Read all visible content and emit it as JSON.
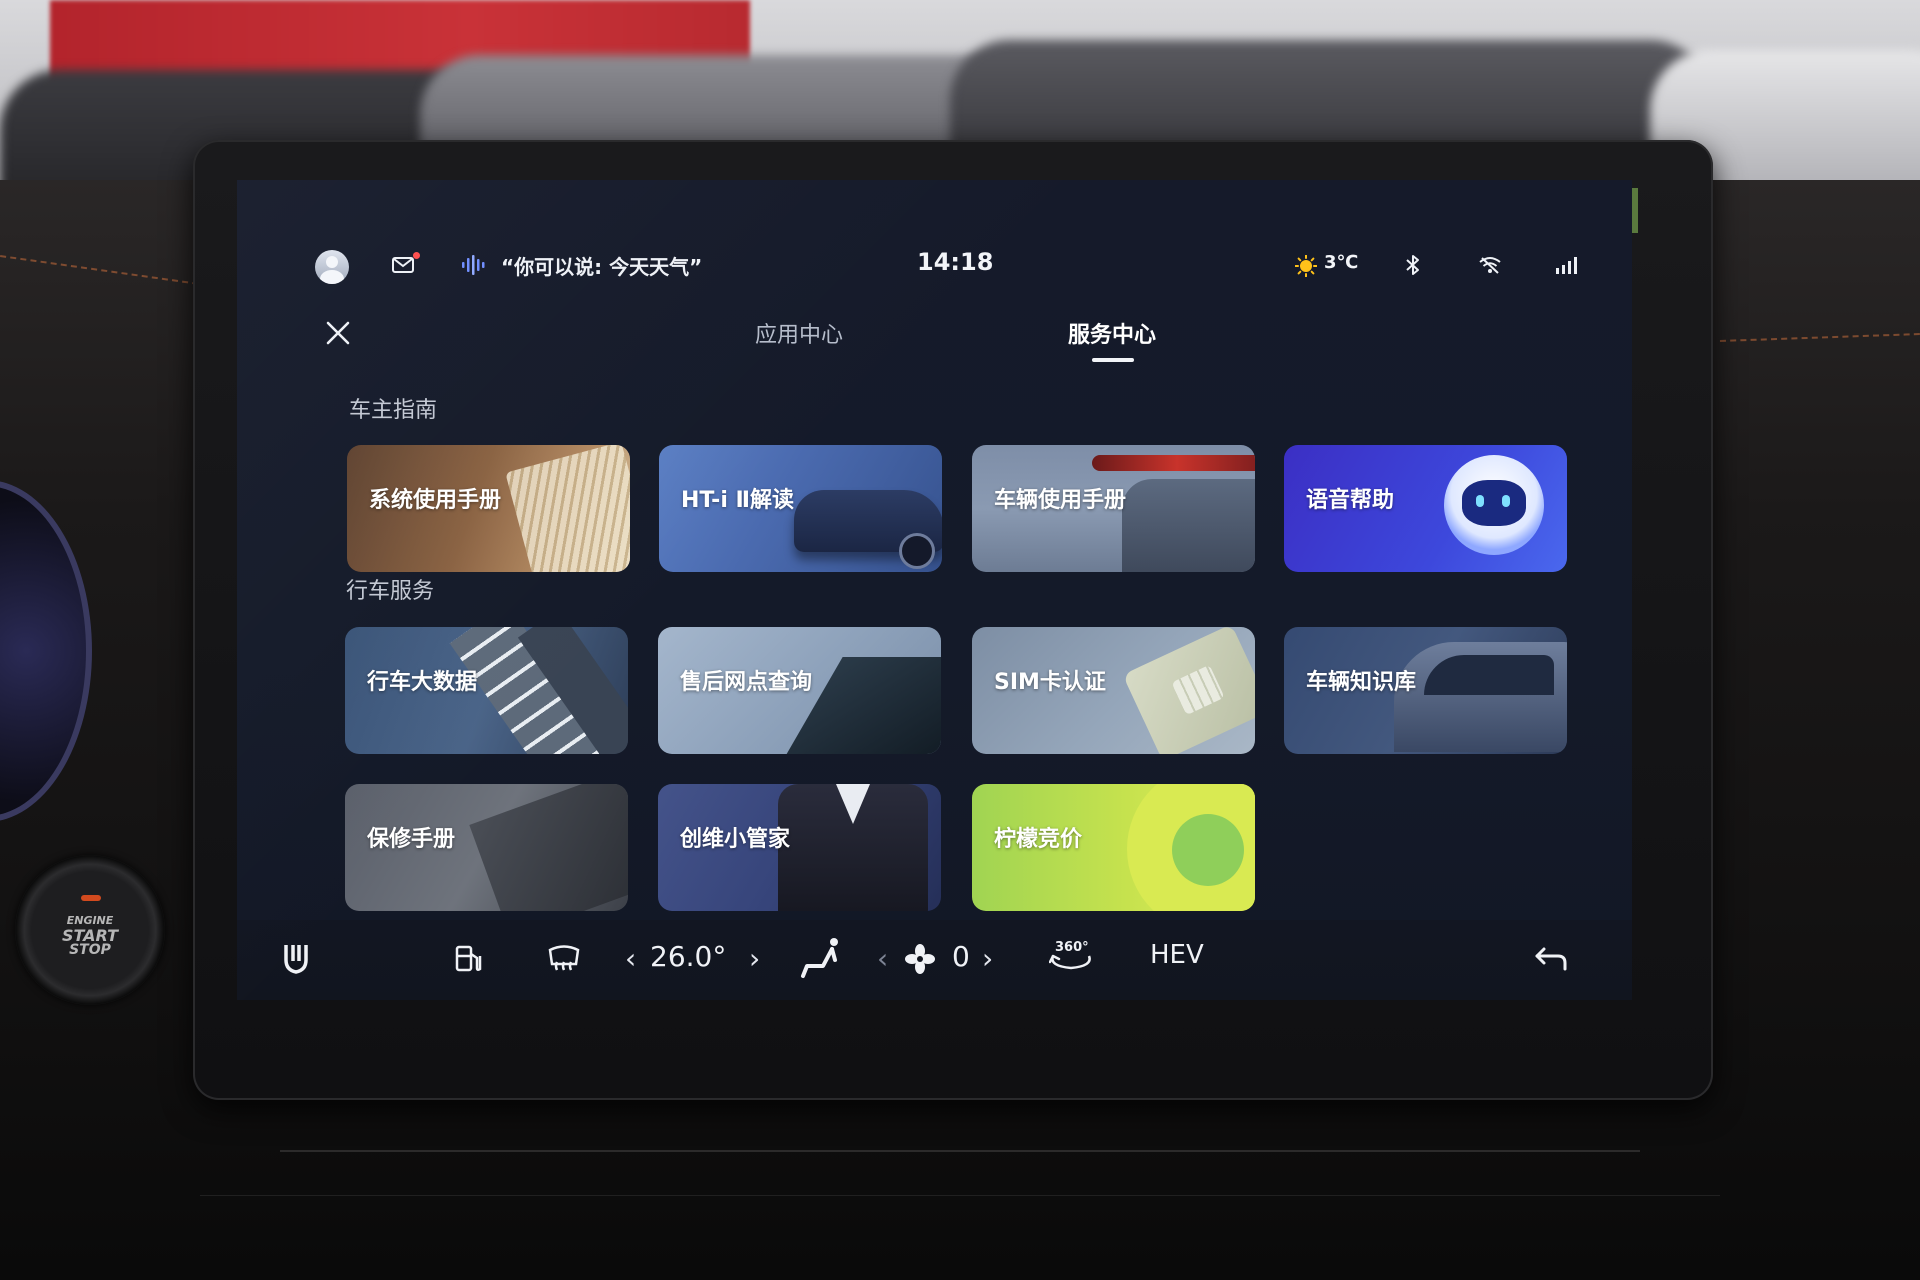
{
  "status_bar": {
    "voice_hint": "“你可以说: 今天天气”",
    "time": "14:18",
    "weather_temp": "3℃",
    "icons": [
      "avatar",
      "mail-icon",
      "voice-wave-icon",
      "sun-icon",
      "bluetooth-icon",
      "wifi-icon",
      "signal-icon"
    ],
    "mail_badge_color": "#ff4d4d"
  },
  "tabs": [
    {
      "label": "应用中心",
      "active": false
    },
    {
      "label": "服务中心",
      "active": true
    }
  ],
  "sections": [
    {
      "title": "车主指南",
      "cards": [
        {
          "label": "系统使用手册",
          "color": "#7a5638",
          "icon": "book-image"
        },
        {
          "label": "HT-i Ⅱ解读",
          "color": "#4a6aa8",
          "icon": "car-image"
        },
        {
          "label": "车辆使用手册",
          "color": "#6b7f9e",
          "icon": "taillight-image"
        },
        {
          "label": "语音帮助",
          "color": "#3a3ad0",
          "icon": "robot-mascot-image"
        }
      ]
    },
    {
      "title": "行车服务",
      "cards": [
        {
          "label": "行车大数据",
          "color": "#3a5478",
          "icon": "road-image"
        },
        {
          "label": "售后网点查询",
          "color": "#8fa3bd",
          "icon": "building-image"
        },
        {
          "label": "SIM卡认证",
          "color": "#8fa0b4",
          "icon": "sim-card-image"
        },
        {
          "label": "车辆知识库",
          "color": "#354a72",
          "icon": "car-side-image"
        },
        {
          "label": "保修手册",
          "color": "#4a4f5a",
          "icon": "book-cover-image"
        },
        {
          "label": "创维小管家",
          "color": "#3c4a7a",
          "icon": "butler-image"
        },
        {
          "label": "柠檬竞价",
          "color": "#a8d65a",
          "icon": "lemon-image"
        }
      ]
    }
  ],
  "bottom_bar": {
    "temperature": "26.0°",
    "fan_speed": "0",
    "camera_label": "360°",
    "mode": "HEV",
    "icons": [
      "app-shield-icon",
      "fuel-icon",
      "rear-defrost-icon",
      "seat-airflow-icon",
      "fan-icon",
      "camera-360-icon",
      "back-icon"
    ]
  },
  "hardware": {
    "start_button": [
      "ENGINE",
      "START",
      "STOP"
    ]
  }
}
